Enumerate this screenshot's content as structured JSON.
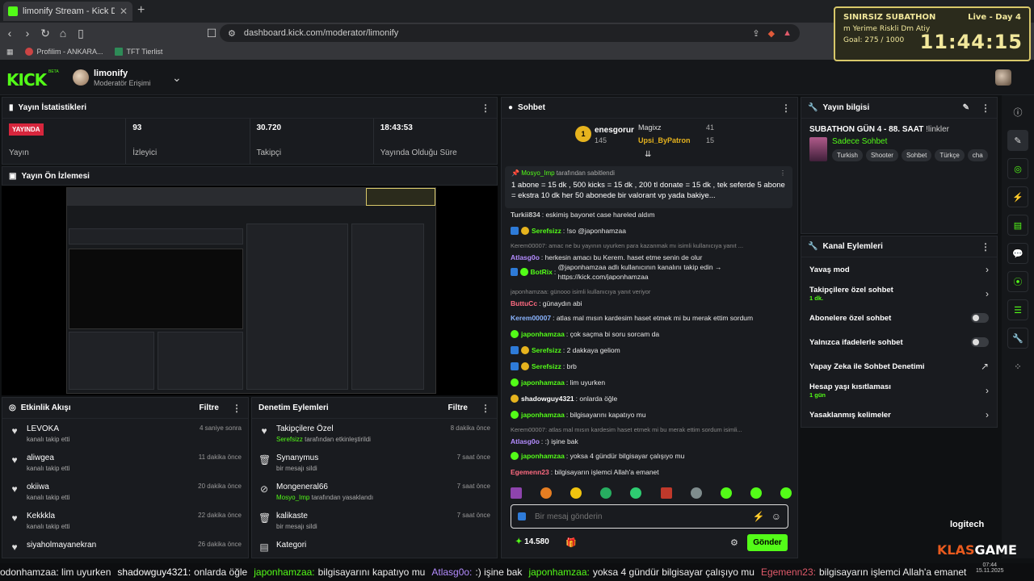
{
  "browser": {
    "tab_title": "limonify Stream - Kick Dashb",
    "url": "dashboard.kick.com/moderator/limonify",
    "bookmarks": [
      "Profilim - ANKARA...",
      "TFT Tierlist"
    ]
  },
  "kick": {
    "logo": "KICK",
    "beta": "BETA",
    "mod_name": "limonify",
    "mod_role": "Moderatör Erişimi"
  },
  "stats": {
    "title": "Yayın İstatistikleri",
    "live_badge": "YAYINDA",
    "items": [
      {
        "value": "",
        "label": "Yayın"
      },
      {
        "value": "93",
        "label": "İzleyici"
      },
      {
        "value": "30.720",
        "label": "Takipçi"
      },
      {
        "value": "18:43:53",
        "label": "Yayında Olduğu Süre"
      }
    ]
  },
  "preview": {
    "title": "Yayın Ön İzlemesi"
  },
  "events": {
    "title": "Etkinlik Akışı",
    "filter": "Filtre",
    "items": [
      {
        "name": "LEVOKA",
        "sub": "kanalı takip etti",
        "time": "4 saniye sonra"
      },
      {
        "name": "aliwgea",
        "sub": "kanalı takip etti",
        "time": "11 dakika önce"
      },
      {
        "name": "okiiwa",
        "sub": "kanalı takip etti",
        "time": "20 dakika önce"
      },
      {
        "name": "Kekkkla",
        "sub": "kanalı takip etti",
        "time": "22 dakika önce"
      },
      {
        "name": "siyaholmayanekran",
        "sub": "",
        "time": "26 dakika önce"
      }
    ]
  },
  "modact": {
    "title": "Denetim Eylemleri",
    "filter": "Filtre",
    "items": [
      {
        "name": "Takipçilere Özel",
        "who": "Serefsizz",
        "sub": "tarafından etkinleştirildi",
        "time": "8 dakika önce",
        "icon": "heart-icon"
      },
      {
        "name": "Synanymus",
        "who": "",
        "sub": "bir mesajı sildi",
        "time": "7 saat önce",
        "icon": "trash-icon"
      },
      {
        "name": "Mongeneral66",
        "who": "Mosyo_Imp",
        "sub": "tarafından yasaklandı",
        "time": "7 saat önce",
        "icon": "ban-icon"
      },
      {
        "name": "kalikaste",
        "who": "",
        "sub": "bir mesajı sildi",
        "time": "7 saat önce",
        "icon": "trash-icon"
      },
      {
        "name": "Kategori",
        "who": "",
        "sub": "",
        "time": "",
        "icon": "category-icon"
      }
    ]
  },
  "chat": {
    "title": "Sohbet",
    "leaders": [
      {
        "rank": "1",
        "name": "enesgorur",
        "count": "145"
      },
      {
        "name": "Magixz",
        "count": "41"
      },
      {
        "name": "Upsi_ByPatron",
        "count": "15"
      }
    ],
    "pinned_by": "Mosyo_Imp",
    "pinned_suffix": "tarafından sabitlendi",
    "pinned_text": "1 abone = 15 dk , 500 kicks = 15 dk , 200 tl donate = 15 dk , tek seferde 5 abone = ekstra 10 dk her 50 abonede bir valorant vp yada bakiye...",
    "messages": [
      {
        "reply": "",
        "user": "Turkii834",
        "color": "#cccccc",
        "text": "eskimiş bayonet case hareled aldım"
      },
      {
        "reply": "",
        "user": "Serefsizz",
        "color": "#53fc18",
        "text": "!so @japonhamzaa"
      },
      {
        "reply": "Kerem00007: amac ne bu yayının uyurken para kazanmak mı isimli kullanıcıya yanıt ...",
        "user": "Atlasg0o",
        "color": "#b48cff",
        "text": "herkesin amacı bu Kerem. haset etme senin de olur"
      },
      {
        "reply": "",
        "user": "BotRix",
        "color": "#53fc18",
        "text": "@japonhamzaa adlı kullanıcının kanalını takip edin → https://kick.com/japonhamzaa"
      },
      {
        "reply": "japonhamzaa: günooo isimli kullanıcıya yanıt veriyor",
        "user": "ButtuCc",
        "color": "#ff6b81",
        "text": "günaydın abi"
      },
      {
        "reply": "",
        "user": "Kerem00007",
        "color": "#8ab4ff",
        "text": "atlas mal mısın kardesim haset etmek mi bu merak ettim sordum"
      },
      {
        "reply": "",
        "user": "japonhamzaa",
        "color": "#53fc18",
        "text": "çok saçma bi soru sorcam da"
      },
      {
        "reply": "",
        "user": "Serefsizz",
        "color": "#53fc18",
        "text": "2 dakkaya geliom"
      },
      {
        "reply": "",
        "user": "Serefsizz",
        "color": "#53fc18",
        "text": "brb"
      },
      {
        "reply": "",
        "user": "japonhamzaa",
        "color": "#53fc18",
        "text": "lim uyurken"
      },
      {
        "reply": "",
        "user": "shadowguy4321",
        "color": "#ffffff",
        "text": "onlarda öğle"
      },
      {
        "reply": "",
        "user": "japonhamzaa",
        "color": "#53fc18",
        "text": "bilgisayarını kapatıyo mu"
      },
      {
        "reply": "Kerem00007: atlas mal mısın kardesim haset etmek mi bu merak ettim sordum isimli...",
        "user": "Atlasg0o",
        "color": "#b48cff",
        "text": ":) işine bak"
      },
      {
        "reply": "",
        "user": "japonhamzaa",
        "color": "#53fc18",
        "text": "yoksa 4 gündür bilgisayar çalışıyo mu"
      },
      {
        "reply": "",
        "user": "Egemenn23",
        "color": "#ff6b81",
        "text": "bilgisayarın işlemci Allah'a emanet"
      }
    ],
    "placeholder": "Bir mesaj gönderin",
    "points": "14.580",
    "send": "Gönder"
  },
  "info": {
    "title": "Yayın bilgisi",
    "stream_title": "SUBATHON GÜN 4 - 88. SAAT",
    "stream_title_suffix": "!linkler",
    "category": "Sadece Sohbet",
    "tags": [
      "Turkish",
      "Shooter",
      "Sohbet",
      "Türkçe",
      "cha"
    ]
  },
  "chanact": {
    "title": "Kanal Eylemleri",
    "items": [
      {
        "label": "Yavaş mod",
        "sub": "",
        "kind": "chevron"
      },
      {
        "label": "Takipçilere özel sohbet",
        "sub": "1 dk.",
        "kind": "chevron"
      },
      {
        "label": "Abonelere özel sohbet",
        "sub": "",
        "kind": "toggle"
      },
      {
        "label": "Yalnızca ifadelerle sohbet",
        "sub": "",
        "kind": "toggle"
      },
      {
        "label": "Yapay Zeka ile Sohbet Denetimi",
        "sub": "",
        "kind": "external"
      },
      {
        "label": "Hesap yaşı kısıtlaması",
        "sub": "1 gün",
        "kind": "chevron"
      },
      {
        "label": "Yasaklanmış kelimeler",
        "sub": "",
        "kind": "chevron"
      }
    ]
  },
  "subathon": {
    "title": "SINIRSIZ SUBATHON",
    "live": "Live - Day 4",
    "sub": "m Yerime Riskli Dm Atiy",
    "goal": "Goal: 275 / 1000",
    "timer": "11:44:15"
  },
  "ticker": {
    "segments": [
      {
        "t": "odonhamzaa: lim uyurken",
        "c": ""
      },
      {
        "t": "shadowguy4321:",
        "c": "w"
      },
      {
        "t": "onlarda öğle",
        "c": ""
      },
      {
        "t": "japonhamzaa:",
        "c": "n"
      },
      {
        "t": "bilgisayarını kapatıyo mu",
        "c": ""
      },
      {
        "t": "Atlasg0o:",
        "c": "p"
      },
      {
        "t": ":) işine bak",
        "c": ""
      },
      {
        "t": "japonhamzaa:",
        "c": "n"
      },
      {
        "t": "yoksa 4 gündür bilgisayar çalışıyo mu",
        "c": ""
      },
      {
        "t": "Egemenn23:",
        "c": "r"
      },
      {
        "t": "bilgisayarın işlemci Allah'a emanet",
        "c": ""
      }
    ]
  },
  "overlay": {
    "logitech": "logitech",
    "klas": "KLAS",
    "game": "GAME",
    "time": "07:44",
    "date": "15.11.2025"
  }
}
